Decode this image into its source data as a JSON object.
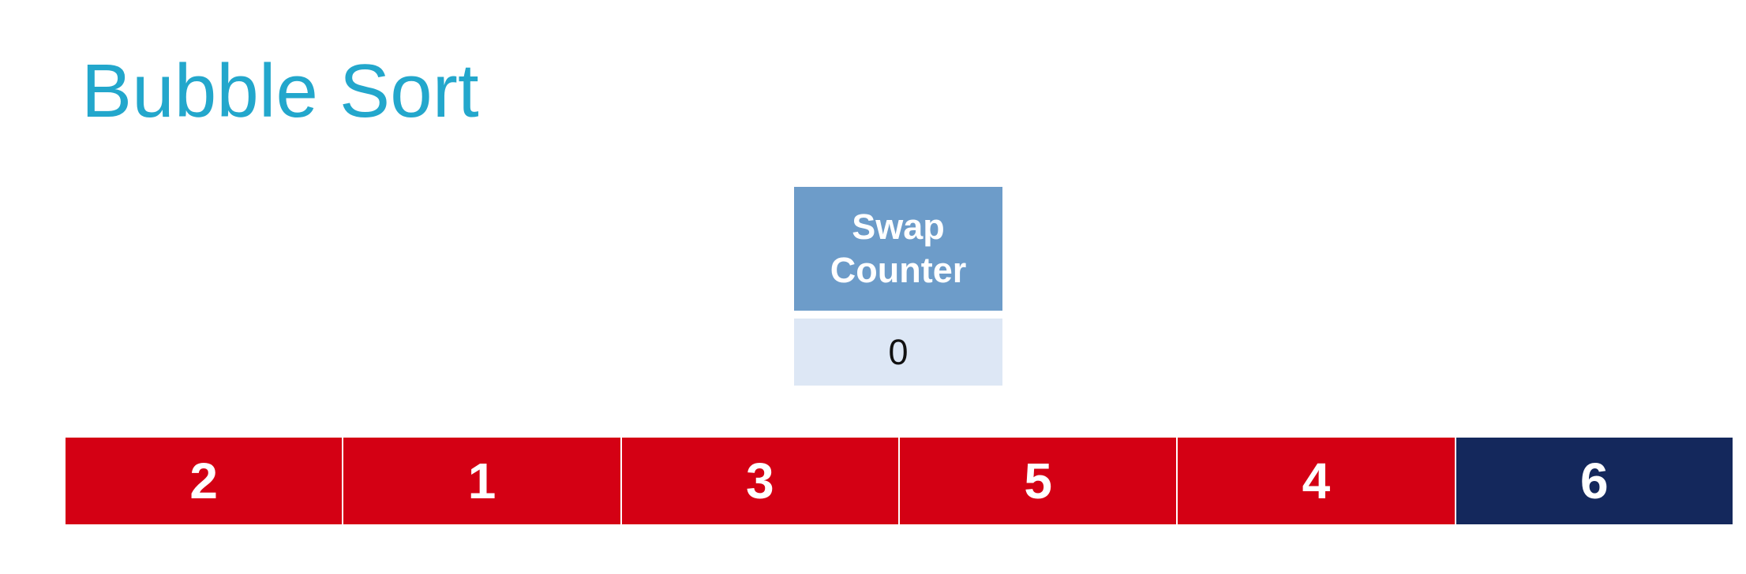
{
  "slide": {
    "title": "Bubble Sort"
  },
  "swap_counter": {
    "label": "Swap\nCounter",
    "value": "0"
  },
  "array": [
    {
      "value": "2",
      "state": "unsorted"
    },
    {
      "value": "1",
      "state": "unsorted"
    },
    {
      "value": "3",
      "state": "unsorted"
    },
    {
      "value": "5",
      "state": "unsorted"
    },
    {
      "value": "4",
      "state": "unsorted"
    },
    {
      "value": "6",
      "state": "sorted"
    }
  ],
  "colors": {
    "title": "#23A7CC",
    "counter_header": "#6D9CC9",
    "counter_value": "#DDE7F5",
    "unsorted": "#D40014",
    "sorted": "#14285C"
  }
}
